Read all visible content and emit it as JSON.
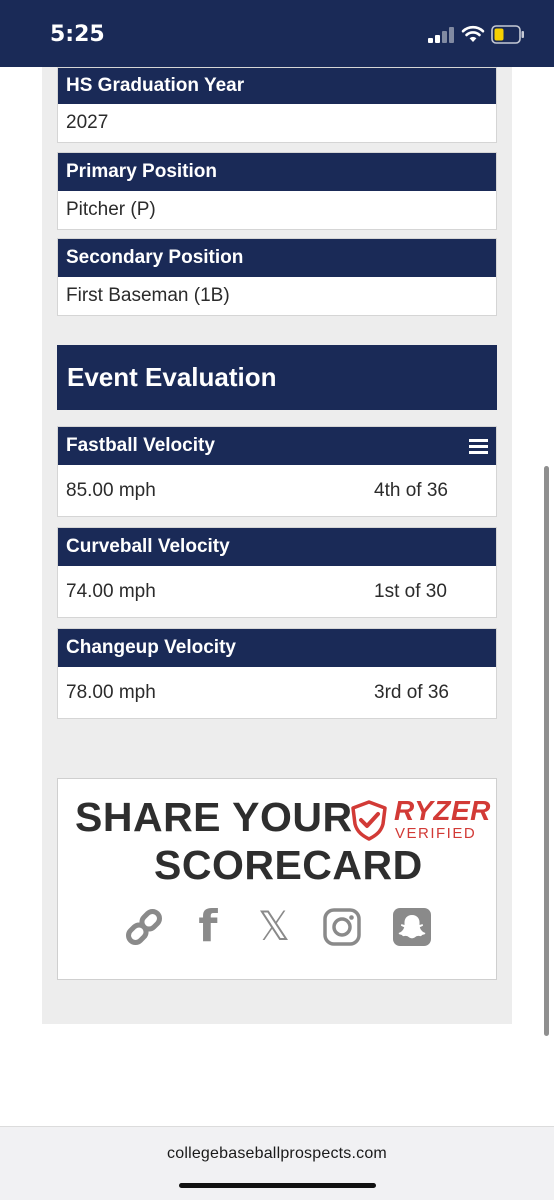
{
  "status_bar": {
    "time": "5:25",
    "signal_icon": "cellular-signal-icon",
    "wifi_icon": "wifi-icon",
    "battery_icon": "battery-low-icon",
    "background": "#1a2a57"
  },
  "profile_fields": [
    {
      "label": "HS Graduation Year",
      "value": "2027"
    },
    {
      "label": "Primary Position",
      "value": "Pitcher (P)"
    },
    {
      "label": "Secondary Position",
      "value": "First Baseman (1B)"
    }
  ],
  "event_evaluation": {
    "title": "Event Evaluation",
    "metrics": [
      {
        "label": "Fastball Velocity",
        "value": "85.00 mph",
        "rank": "4th of 36",
        "icon": "list-icon"
      },
      {
        "label": "Curveball Velocity",
        "value": "74.00 mph",
        "rank": "1st of 30"
      },
      {
        "label": "Changeup Velocity",
        "value": "78.00 mph",
        "rank": "3rd of 36"
      }
    ]
  },
  "share": {
    "line1": "SHARE YOUR",
    "line2": "SCORECARD",
    "brand_name": "RYZER",
    "brand_sub": "VERIFIED",
    "brand_color": "#d23a36",
    "icons": [
      "link-icon",
      "facebook-icon",
      "x-icon",
      "instagram-icon",
      "snapchat-icon"
    ],
    "facebook_glyph": "f",
    "x_glyph": "𝕏"
  },
  "browser": {
    "url": "collegebaseballprospects.com"
  },
  "colors": {
    "header_navy": "#1a2a57",
    "panel_gray": "#ededed",
    "icon_gray": "#8a8a8a"
  }
}
